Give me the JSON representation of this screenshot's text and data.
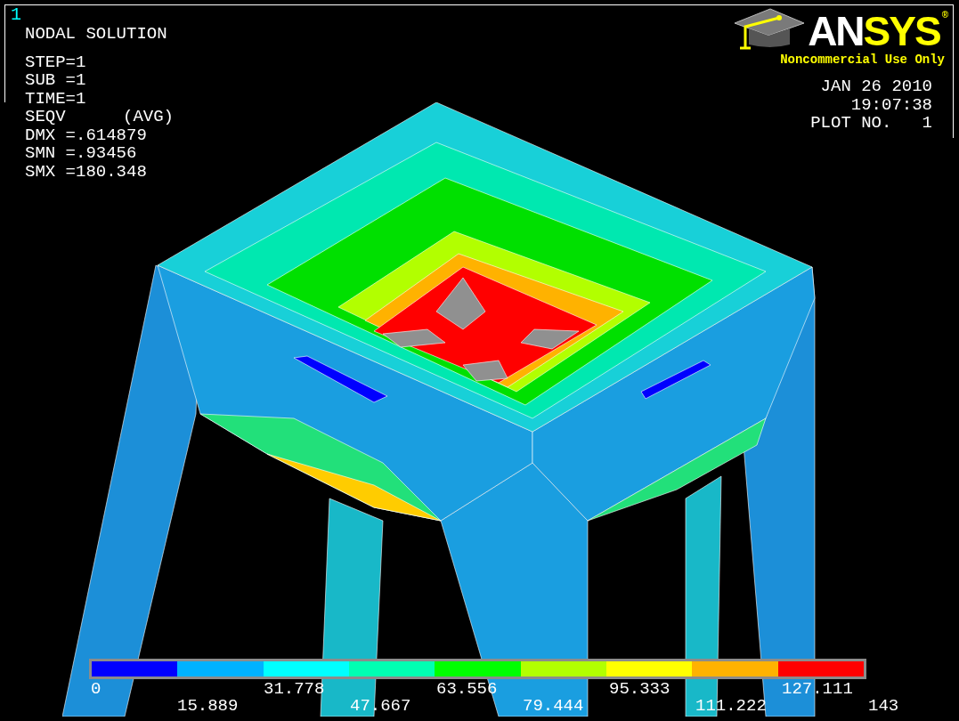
{
  "window_number": "1",
  "info": {
    "title": "NODAL SOLUTION",
    "lines": [
      "STEP=1",
      "SUB =1",
      "TIME=1"
    ],
    "result": "SEQV",
    "averaging": "(AVG)",
    "stats": [
      "DMX =.614879",
      "SMN =.93456",
      "SMX =180.348"
    ]
  },
  "logo": {
    "word_white": "AN",
    "word_yellow": "SYS",
    "mark": "®",
    "license": "Noncommercial Use Only"
  },
  "plot_info": [
    "JAN 26 2010",
    "19:07:38",
    "PLOT NO.   1"
  ],
  "legend": {
    "segments": [
      {
        "color": "#0000ff"
      },
      {
        "color": "#00b2ff"
      },
      {
        "color": "#00ffff"
      },
      {
        "color": "#00ffb2"
      },
      {
        "color": "#00ff00"
      },
      {
        "color": "#b2ff00"
      },
      {
        "color": "#ffff00"
      },
      {
        "color": "#ffb200"
      },
      {
        "color": "#ff0000"
      }
    ],
    "labels": [
      "0",
      "15.889",
      "31.778",
      "47.667",
      "63.556",
      "79.444",
      "95.333",
      "111.222",
      "127.111",
      "143"
    ]
  }
}
